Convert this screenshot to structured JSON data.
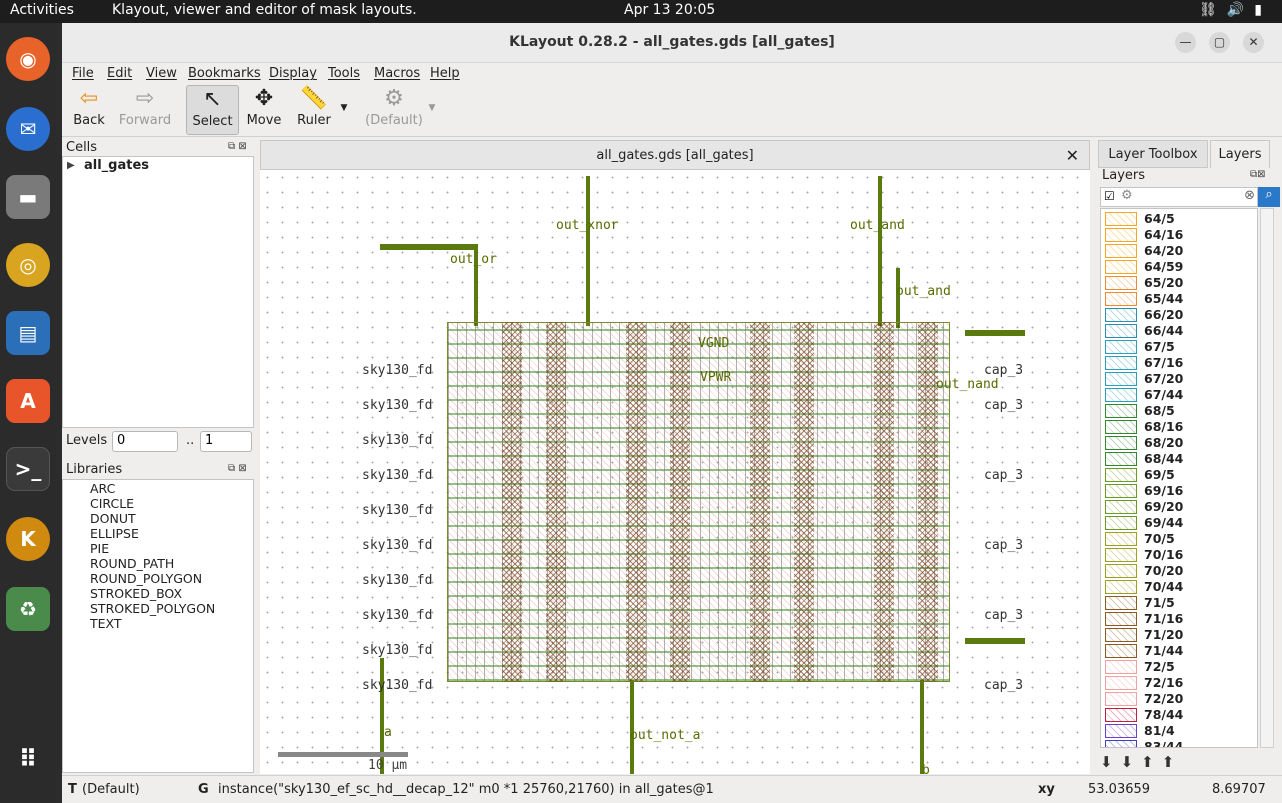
{
  "topbar": {
    "activities": "Activities",
    "app_title": "Klayout, viewer and editor of mask layouts.",
    "clock": "Apr 13  20:05"
  },
  "window": {
    "title": "KLayout 0.28.2 - all_gates.gds [all_gates]"
  },
  "menu": [
    "File",
    "Edit",
    "View",
    "Bookmarks",
    "Display",
    "Tools",
    "Macros",
    "Help"
  ],
  "toolbar": {
    "back": "Back",
    "forward": "Forward",
    "select": "Select",
    "move": "Move",
    "ruler": "Ruler",
    "default": "(Default)"
  },
  "cells": {
    "header": "Cells",
    "root": "all_gates"
  },
  "levels": {
    "label": "Levels",
    "from": "0",
    "sep": "..",
    "to": "1"
  },
  "libraries": {
    "header": "Libraries",
    "items": [
      "ARC",
      "CIRCLE",
      "DONUT",
      "ELLIPSE",
      "PIE",
      "ROUND_PATH",
      "ROUND_POLYGON",
      "STROKED_BOX",
      "STROKED_POLYGON",
      "TEXT"
    ]
  },
  "view": {
    "tab_title": "all_gates.gds [all_gates]",
    "labels": {
      "out_xnor": "out_xnor",
      "out_and_top": "out_and",
      "out_or": "out_or",
      "out_and": "out_and",
      "vgnd": "VGND",
      "vpwr": "VPWR",
      "out_nand": "out_nand",
      "a": "a",
      "out_not_a": "out_not_a",
      "b": "b"
    },
    "row_prefix": "sky130_fd",
    "row_suffix": "cap_3",
    "scale": "10 µm"
  },
  "right": {
    "tab_toolbox": "Layer Toolbox",
    "tab_layers": "Layers",
    "layers_header": "Layers",
    "layers": [
      {
        "name": "64/5",
        "color": "#f5a623"
      },
      {
        "name": "64/16",
        "color": "#f5a623"
      },
      {
        "name": "64/20",
        "color": "#f5a623"
      },
      {
        "name": "64/59",
        "color": "#f5a623"
      },
      {
        "name": "65/20",
        "color": "#f08a30"
      },
      {
        "name": "65/44",
        "color": "#f08a30"
      },
      {
        "name": "66/20",
        "color": "#2a8fb0"
      },
      {
        "name": "66/44",
        "color": "#2a8fb0"
      },
      {
        "name": "67/5",
        "color": "#2aa0b8"
      },
      {
        "name": "67/16",
        "color": "#2aa0b8"
      },
      {
        "name": "67/20",
        "color": "#2aa0b8"
      },
      {
        "name": "67/44",
        "color": "#2aa0b8"
      },
      {
        "name": "68/5",
        "color": "#2f8a2f"
      },
      {
        "name": "68/16",
        "color": "#2f8a2f"
      },
      {
        "name": "68/20",
        "color": "#2f8a2f"
      },
      {
        "name": "68/44",
        "color": "#2f8a2f"
      },
      {
        "name": "69/5",
        "color": "#6a9a20"
      },
      {
        "name": "69/16",
        "color": "#6a9a20"
      },
      {
        "name": "69/20",
        "color": "#6a9a20"
      },
      {
        "name": "69/44",
        "color": "#6a9a20"
      },
      {
        "name": "70/5",
        "color": "#a0a020"
      },
      {
        "name": "70/16",
        "color": "#a0a020"
      },
      {
        "name": "70/20",
        "color": "#a0a020"
      },
      {
        "name": "70/44",
        "color": "#a0a020"
      },
      {
        "name": "71/5",
        "color": "#8a5a20"
      },
      {
        "name": "71/16",
        "color": "#8a5a20"
      },
      {
        "name": "71/20",
        "color": "#8a5a20"
      },
      {
        "name": "71/44",
        "color": "#8a5a20"
      },
      {
        "name": "72/5",
        "color": "#f0a0a0"
      },
      {
        "name": "72/16",
        "color": "#f0a0a0"
      },
      {
        "name": "72/20",
        "color": "#f0a0a0"
      },
      {
        "name": "78/44",
        "color": "#c02040"
      },
      {
        "name": "81/4",
        "color": "#6a40d0"
      },
      {
        "name": "83/44",
        "color": "#4040c0"
      }
    ]
  },
  "status": {
    "t_label": "T",
    "t_value": "(Default)",
    "g_label": "G",
    "g_value": "instance(\"sky130_ef_sc_hd__decap_12\" m0 *1 25760,21760) in all_gates@1",
    "xy_label": "xy",
    "x": "53.03659",
    "y": "8.69707"
  }
}
